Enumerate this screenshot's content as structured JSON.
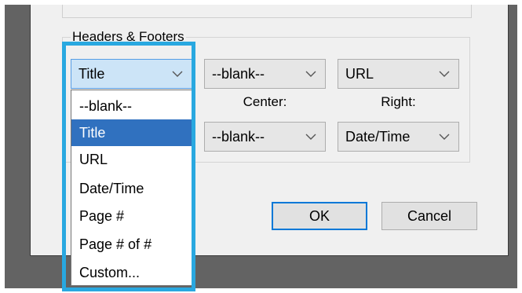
{
  "headers_footers": {
    "group_label": "Headers & Footers",
    "header_left": "Title",
    "header_center": "--blank--",
    "header_right": "URL",
    "center_label": "Center:",
    "right_label": "Right:",
    "footer_center": "--blank--",
    "footer_right": "Date/Time"
  },
  "dropdown": {
    "items": [
      "--blank--",
      "Title",
      "URL",
      "Date/Time",
      "Page #",
      "Page # of #",
      "Custom..."
    ],
    "selected": "Title"
  },
  "buttons": {
    "ok": "OK",
    "cancel": "Cancel"
  },
  "colors": {
    "highlight": "#29a8e0",
    "selection": "#3071bf",
    "default_button_border": "#0078d7"
  }
}
